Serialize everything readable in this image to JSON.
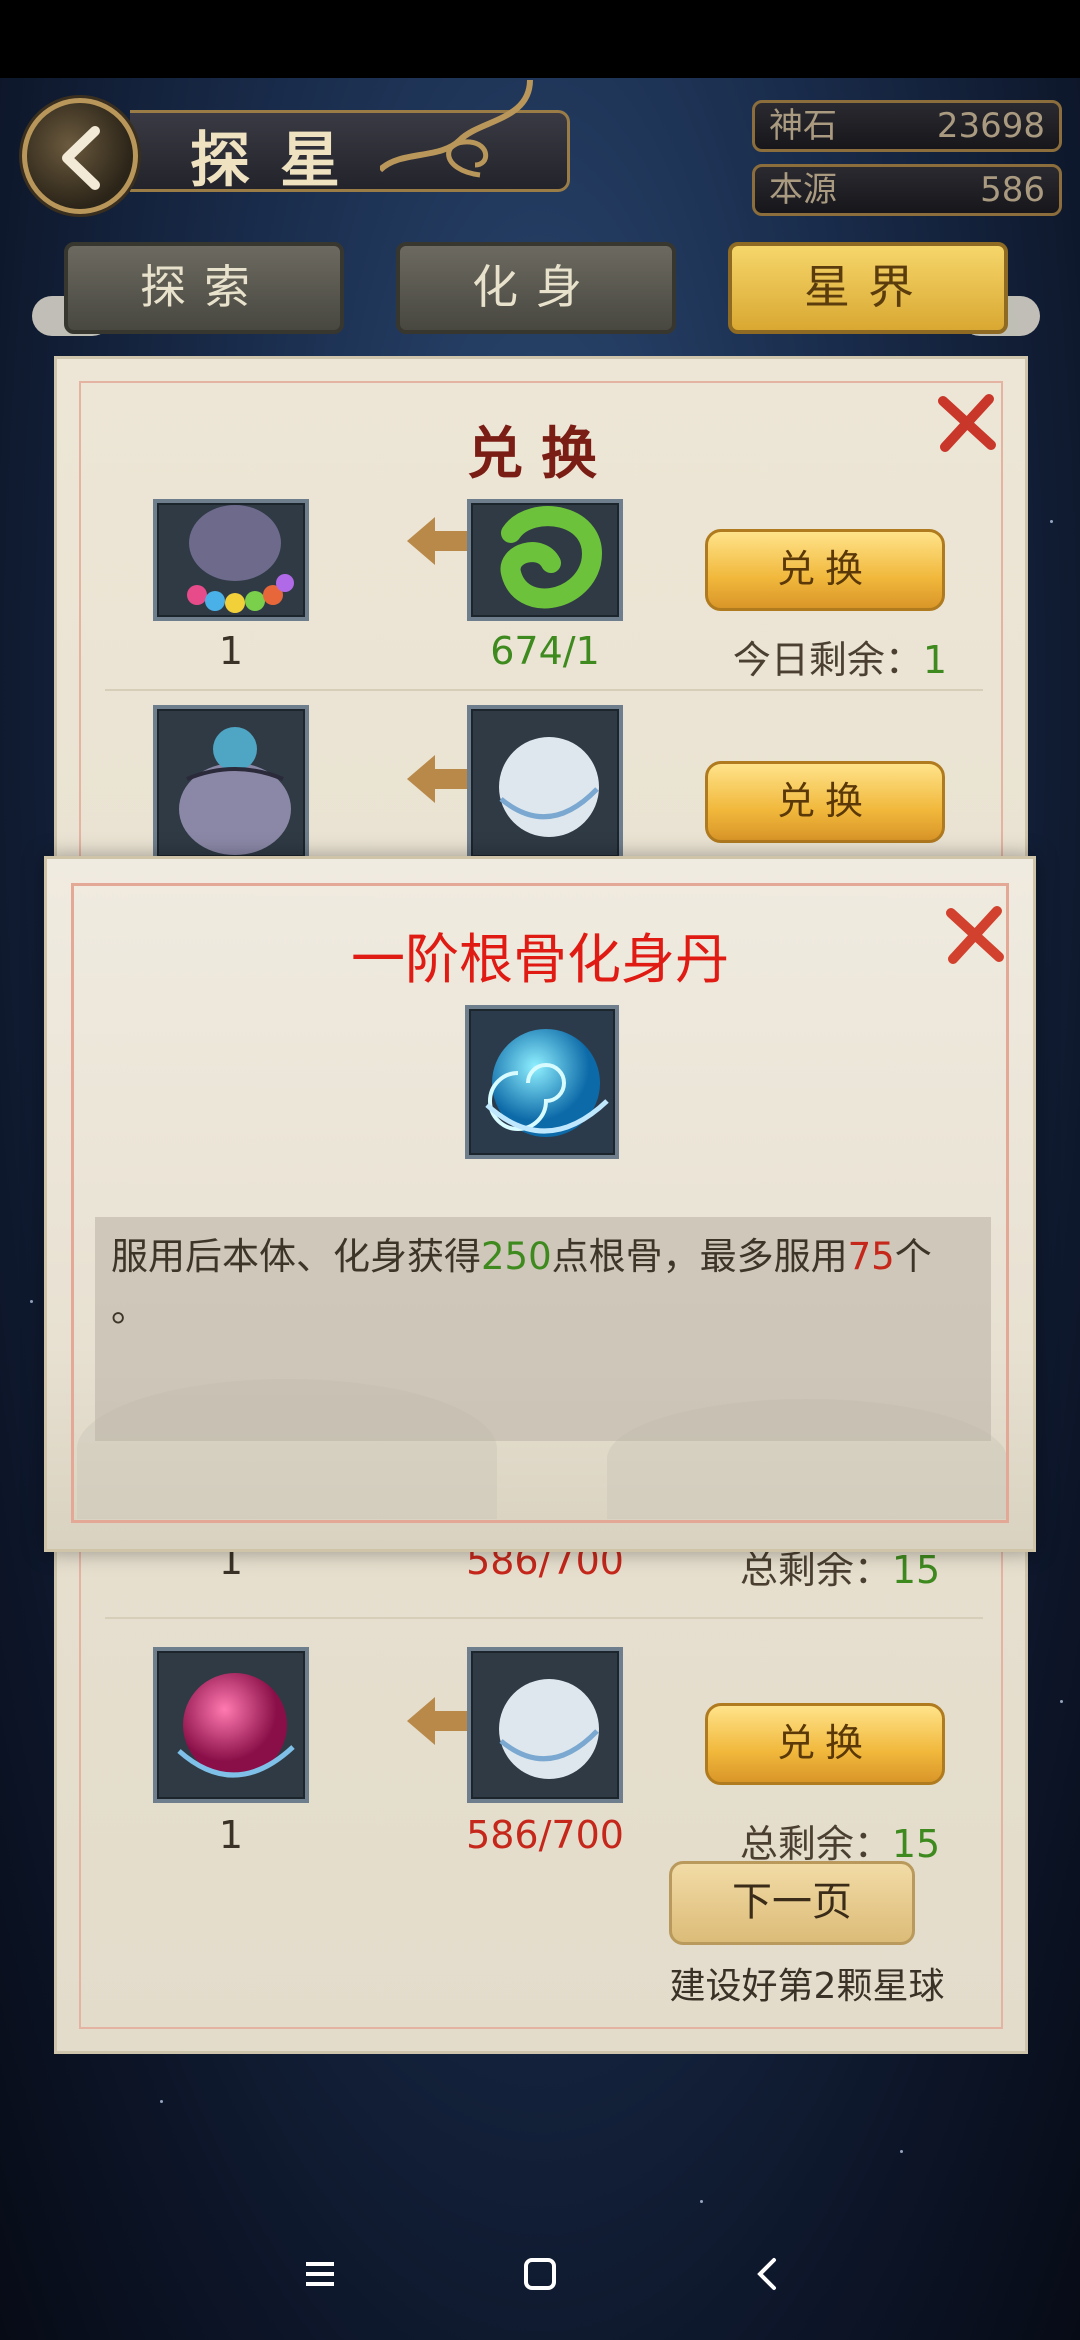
{
  "header": {
    "title": "探星",
    "currencies": [
      {
        "label": "神石",
        "value": "23698"
      },
      {
        "label": "本源",
        "value": "586"
      }
    ]
  },
  "tabs": [
    {
      "label": "探索",
      "active": false
    },
    {
      "label": "化身",
      "active": false
    },
    {
      "label": "星界",
      "active": true
    }
  ],
  "exchange": {
    "title": "兑换",
    "rows": [
      {
        "reward_icon": "orb-bag-icon",
        "reward_count": "1",
        "cost_icon": "jade-dragon-icon",
        "cost_value": "674/1",
        "cost_color": "#3e8a1f",
        "button_label": "兑换",
        "remain_label": "今日剩余：",
        "remain_value": "1"
      },
      {
        "reward_icon": "blue-orb-bag-icon",
        "reward_count": "",
        "cost_icon": "white-orb-icon",
        "cost_value": "",
        "button_label": "兑换",
        "remain_label": "",
        "remain_value": ""
      },
      {
        "reward_icon": "",
        "reward_count": "1",
        "cost_icon": "",
        "cost_value": "586/700",
        "cost_color": "#c6271b",
        "button_label": "",
        "remain_label": "总剩余：",
        "remain_value": "15"
      },
      {
        "reward_icon": "pink-pill-icon",
        "reward_count": "1",
        "cost_icon": "white-orb-icon",
        "cost_value": "586/700",
        "cost_color": "#c6271b",
        "button_label": "兑换",
        "remain_label": "总剩余：",
        "remain_value": "15"
      }
    ],
    "next_page_label": "下一页",
    "next_page_note": "建设好第2颗星球"
  },
  "popup": {
    "title": "一阶根骨化身丹",
    "item_icon": "blue-pill-icon",
    "desc_part1": "服用后本体、化身获得",
    "desc_num1": "250",
    "desc_part2": "点根骨，最多服用",
    "desc_num2": "75",
    "desc_part3": "个",
    "desc_part4": "。"
  },
  "colors": {
    "accent_green": "#3e8a1f",
    "accent_red": "#c6271b",
    "title_red": "#e01b13",
    "gold": "#f1b83c"
  }
}
